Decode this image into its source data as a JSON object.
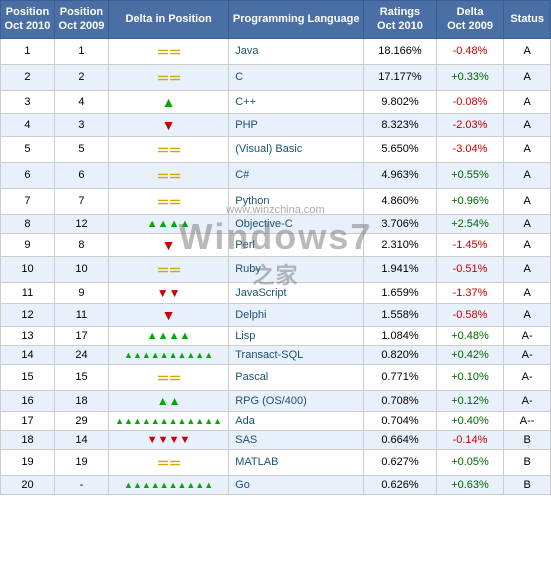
{
  "table": {
    "headers": [
      "Position\nOct 2010",
      "Position\nOct 2009",
      "Delta in Position",
      "Programming Language",
      "Ratings\nOct 2010",
      "Delta\nOct 2009",
      "Status"
    ],
    "rows": [
      {
        "pos2010": "1",
        "pos2009": "1",
        "delta": "equal",
        "delta_arrows": "==",
        "lang": "Java",
        "rating": "18.166%",
        "delta_rating": "-0.48%",
        "status": "A"
      },
      {
        "pos2010": "2",
        "pos2009": "2",
        "delta": "equal",
        "delta_arrows": "==",
        "lang": "C",
        "rating": "17.177%",
        "delta_rating": "+0.33%",
        "status": "A"
      },
      {
        "pos2010": "3",
        "pos2009": "4",
        "delta": "up",
        "delta_arrows": "↑",
        "lang": "C++",
        "rating": "9.802%",
        "delta_rating": "-0.08%",
        "status": "A"
      },
      {
        "pos2010": "4",
        "pos2009": "3",
        "delta": "down",
        "delta_arrows": "↓",
        "lang": "PHP",
        "rating": "8.323%",
        "delta_rating": "-2.03%",
        "status": "A"
      },
      {
        "pos2010": "5",
        "pos2009": "5",
        "delta": "equal",
        "delta_arrows": "==",
        "lang": "(Visual) Basic",
        "rating": "5.650%",
        "delta_rating": "-3.04%",
        "status": "A"
      },
      {
        "pos2010": "6",
        "pos2009": "6",
        "delta": "equal",
        "delta_arrows": "==",
        "lang": "C#",
        "rating": "4.963%",
        "delta_rating": "+0.55%",
        "status": "A"
      },
      {
        "pos2010": "7",
        "pos2009": "7",
        "delta": "equal",
        "delta_arrows": "==",
        "lang": "Python",
        "rating": "4.860%",
        "delta_rating": "+0.96%",
        "status": "A"
      },
      {
        "pos2010": "8",
        "pos2009": "12",
        "delta": "up4",
        "delta_arrows": "↑↑↑↑",
        "lang": "Objective-C",
        "rating": "3.706%",
        "delta_rating": "+2.54%",
        "status": "A"
      },
      {
        "pos2010": "9",
        "pos2009": "8",
        "delta": "down",
        "delta_arrows": "↓",
        "lang": "Perl",
        "rating": "2.310%",
        "delta_rating": "-1.45%",
        "status": "A"
      },
      {
        "pos2010": "10",
        "pos2009": "10",
        "delta": "equal",
        "delta_arrows": "==",
        "lang": "Ruby",
        "rating": "1.941%",
        "delta_rating": "-0.51%",
        "status": "A"
      },
      {
        "pos2010": "11",
        "pos2009": "9",
        "delta": "down2",
        "delta_arrows": "↓↓",
        "lang": "JavaScript",
        "rating": "1.659%",
        "delta_rating": "-1.37%",
        "status": "A"
      },
      {
        "pos2010": "12",
        "pos2009": "11",
        "delta": "down",
        "delta_arrows": "↓",
        "lang": "Delphi",
        "rating": "1.558%",
        "delta_rating": "-0.58%",
        "status": "A"
      },
      {
        "pos2010": "13",
        "pos2009": "17",
        "delta": "up4",
        "delta_arrows": "↑↑↑↑",
        "lang": "Lisp",
        "rating": "1.084%",
        "delta_rating": "+0.48%",
        "status": "A-"
      },
      {
        "pos2010": "14",
        "pos2009": "24",
        "delta": "up10",
        "delta_arrows": "↑↑↑↑↑↑↑↑↑↑",
        "lang": "Transact-SQL",
        "rating": "0.820%",
        "delta_rating": "+0.42%",
        "status": "A-"
      },
      {
        "pos2010": "15",
        "pos2009": "15",
        "delta": "equal",
        "delta_arrows": "==",
        "lang": "Pascal",
        "rating": "0.771%",
        "delta_rating": "+0.10%",
        "status": "A-"
      },
      {
        "pos2010": "16",
        "pos2009": "18",
        "delta": "up2",
        "delta_arrows": "↑↑",
        "lang": "RPG (OS/400)",
        "rating": "0.708%",
        "delta_rating": "+0.12%",
        "status": "A-"
      },
      {
        "pos2010": "17",
        "pos2009": "29",
        "delta": "up12",
        "delta_arrows": "↑↑↑↑↑↑↑↑↑↑↑↑",
        "lang": "Ada",
        "rating": "0.704%",
        "delta_rating": "+0.40%",
        "status": "A--"
      },
      {
        "pos2010": "18",
        "pos2009": "14",
        "delta": "down4red",
        "delta_arrows": "↓↓↓↓",
        "lang": "SAS",
        "rating": "0.664%",
        "delta_rating": "-0.14%",
        "status": "B"
      },
      {
        "pos2010": "19",
        "pos2009": "19",
        "delta": "equal",
        "delta_arrows": "==",
        "lang": "MATLAB",
        "rating": "0.627%",
        "delta_rating": "+0.05%",
        "status": "B"
      },
      {
        "pos2010": "20",
        "pos2009": "-",
        "delta": "up10",
        "delta_arrows": "↑↑↑↑↑↑↑↑↑↑",
        "lang": "Go",
        "rating": "0.626%",
        "delta_rating": "+0.63%",
        "status": "B"
      }
    ]
  }
}
